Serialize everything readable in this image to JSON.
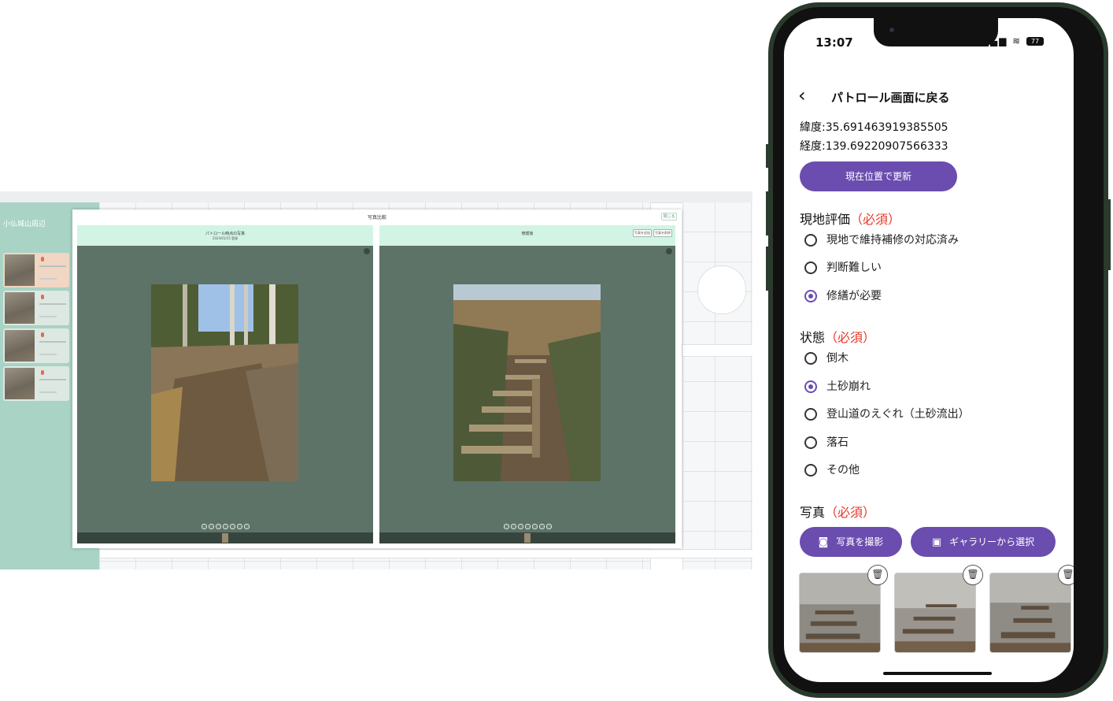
{
  "desktop": {
    "modal_title": "写真比較",
    "close_label": "閉じる",
    "panels": [
      {
        "title": "パトロール時点の写真",
        "subtitle": "2024/01/15 登録",
        "buttons": []
      },
      {
        "title": "修繕後",
        "subtitle": "",
        "buttons": [
          "写真を追加",
          "写真を削除"
        ]
      }
    ],
    "sidebar_title": "小仏城山周辺"
  },
  "phone": {
    "time": "13:07",
    "status": "▂▄▆ ≋",
    "battery": "77",
    "back_icon": "‹",
    "nav_title": "パトロール画面に戻る",
    "latitude": "緯度:35.691463919385505",
    "longitude": "経度:139.69220907566333",
    "update_location_button": "現在位置で更新",
    "evaluation": {
      "title": "現地評価",
      "required": "（必須）",
      "options": [
        "現地で維持補修の対応済み",
        "判断難しい",
        "修繕が必要"
      ],
      "selected": "修繕が必要"
    },
    "condition": {
      "title": "状態",
      "required": "（必須）",
      "options": [
        "倒木",
        "土砂崩れ",
        "登山道のえぐれ（土砂流出）",
        "落石",
        "その他"
      ],
      "selected": "土砂崩れ"
    },
    "photo": {
      "title": "写真",
      "required": "（必須）",
      "take_photo_button": "写真を撮影",
      "gallery_button": "ギャラリーから選択",
      "camera_icon": "camera-icon",
      "gallery_icon": "image-icon",
      "delete_icon": "trash-icon",
      "trash_glyph": "🗑"
    }
  },
  "colors": {
    "accent": "#6a4dae",
    "required": "#e8362a",
    "panel_bg": "#5d7367",
    "panel_head": "#d2f4e5",
    "sidebar": "#a8d3c5"
  }
}
